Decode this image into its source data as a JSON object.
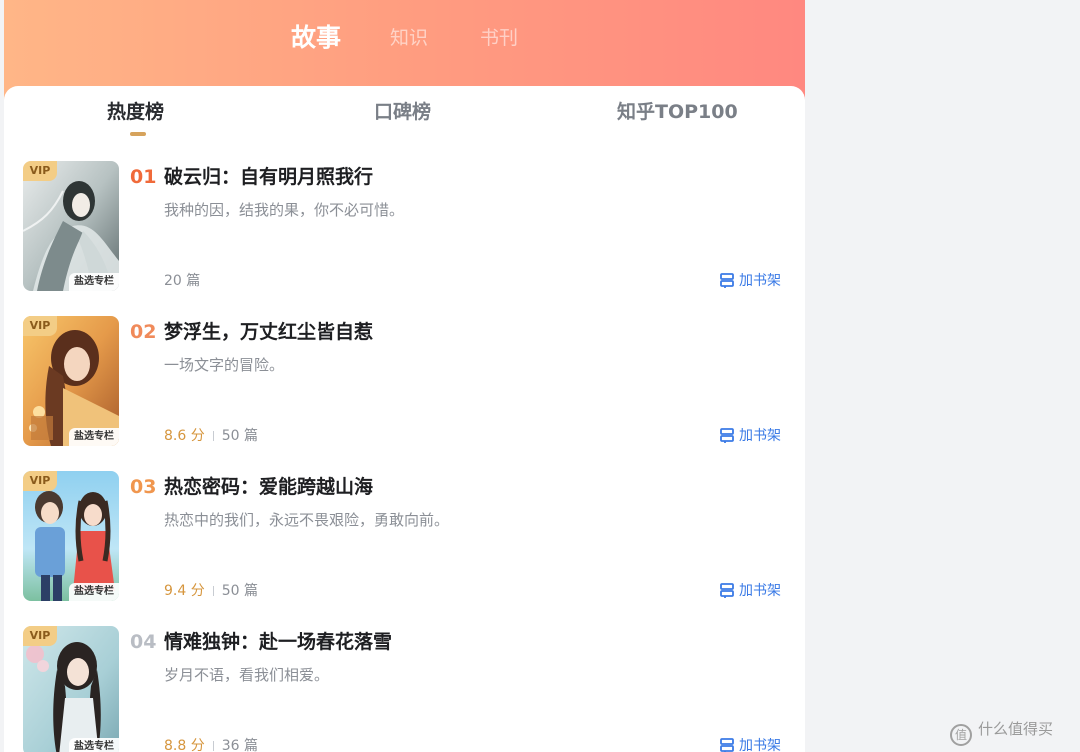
{
  "top_tabs": [
    "故事",
    "知识",
    "书刊"
  ],
  "rank_tabs": [
    "热度榜",
    "口碑榜",
    "知乎TOP100"
  ],
  "vip_label": "VIP",
  "cover_tag": "盐选专栏",
  "shelf_label": "加书架",
  "colors": {
    "header_start": "#ffb687",
    "header_end": "#ff8880",
    "rank_1": "#f06a3a",
    "rank_2": "#f08a5a",
    "rank_3": "#f0964e",
    "rank_4": "#b9bdc4",
    "score": "#d6963e",
    "link": "#3a7ae6"
  },
  "books": [
    {
      "rank": "01",
      "title": "破云归：自有明月照我行",
      "desc": "我种的因，结我的果，你不必可惜。",
      "score": "",
      "count": "20 篇"
    },
    {
      "rank": "02",
      "title": "梦浮生，万丈红尘皆自惹",
      "desc": "一场文字的冒险。",
      "score": "8.6 分",
      "count": "50 篇"
    },
    {
      "rank": "03",
      "title": "热恋密码：爱能跨越山海",
      "desc": "热恋中的我们，永远不畏艰险，勇敢向前。",
      "score": "9.4 分",
      "count": "50 篇"
    },
    {
      "rank": "04",
      "title": "情难独钟：赴一场春花落雪",
      "desc": "岁月不语，看我们相爱。",
      "score": "8.8 分",
      "count": "36 篇"
    }
  ],
  "watermark": {
    "icon": "值",
    "text": "什么值得买"
  }
}
